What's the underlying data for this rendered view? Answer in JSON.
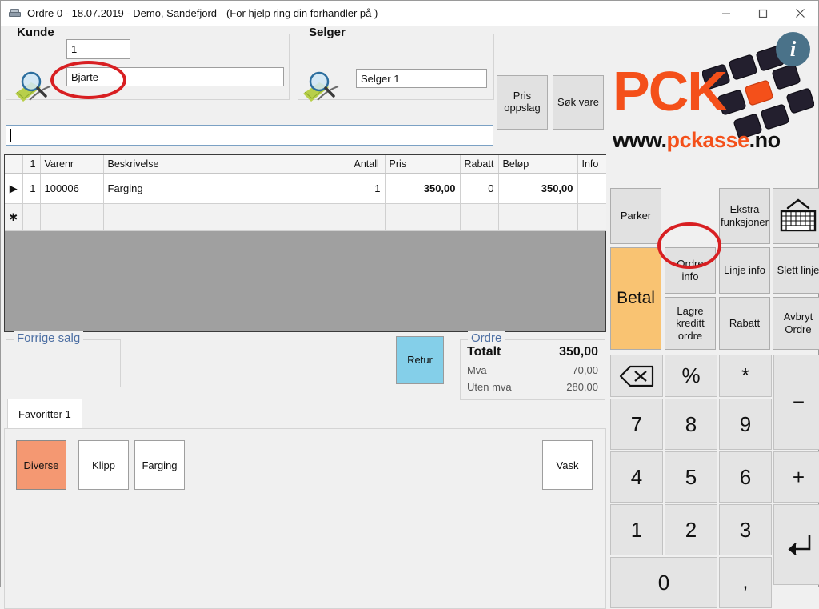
{
  "window": {
    "title": "Ordre 0 - 18.07.2019 - Demo, Sandefjord",
    "help_text": "(For hjelp ring din forhandler  på )",
    "icon": "printer-icon",
    "minimize_label": "minimize-icon",
    "maximize_label": "maximize-icon",
    "close_label": "close-icon"
  },
  "kunde": {
    "legend": "Kunde",
    "number_value": "1",
    "name_value": "Bjarte",
    "search_icon": "magnifier-icon"
  },
  "selger": {
    "legend": "Selger",
    "name_value": "Selger 1",
    "search_icon": "magnifier-icon"
  },
  "toolbar": {
    "pris_oppslag_line1": "Pris",
    "pris_oppslag_line2": "oppslag",
    "sok_vare": "Søk vare"
  },
  "scan": {
    "value": "",
    "placeholder": ""
  },
  "grid": {
    "columns": [
      "1",
      "Varenr",
      "Beskrivelse",
      "Antall",
      "Pris",
      "Rabatt",
      "Beløp",
      "Info"
    ],
    "rows": [
      {
        "marker": "▶",
        "num": "1",
        "varenr": "100006",
        "beskrivelse": "Farging",
        "antall": "1",
        "pris": "350,00",
        "rabatt": "0",
        "belop": "350,00",
        "info": ""
      }
    ],
    "new_row_marker": "✱"
  },
  "forrige_salg": {
    "legend": "Forrige salg"
  },
  "retur": {
    "label": "Retur"
  },
  "ordre_sum": {
    "legend": "Ordre",
    "total_label": "Totalt",
    "total_value": "350,00",
    "mva_label": "Mva",
    "mva_value": "70,00",
    "uten_mva_label": "Uten mva",
    "uten_mva_value": "280,00"
  },
  "favoritter": {
    "tab_label": "Favoritter 1",
    "buttons": [
      {
        "label": "Diverse",
        "selected": true
      },
      {
        "label": "Klipp",
        "selected": false
      },
      {
        "label": "Farging",
        "selected": false
      },
      {
        "label": "Vask",
        "selected": false
      }
    ]
  },
  "logo": {
    "brand": "PCK",
    "url_www": "www.",
    "url_name": "pckasse",
    "url_tld": ".no",
    "info_icon": "info-icon",
    "info_glyph": "i"
  },
  "actions": {
    "parker": "Parker",
    "ekstra_line1": "Ekstra",
    "ekstra_line2": "funksjoner",
    "keyboard_icon": "keyboard-icon",
    "betal": "Betal",
    "ordre_info_line1": "Ordre",
    "ordre_info_line2": "info",
    "linje_info": "Linje info",
    "slett_linje": "Slett linje",
    "lagre_line1": "Lagre",
    "lagre_line2": "kreditt",
    "lagre_line3": "ordre",
    "rabatt": "Rabatt",
    "avbryt_line1": "Avbryt",
    "avbryt_line2": "Ordre"
  },
  "keypad": {
    "backspace": "backspace-icon",
    "percent": "%",
    "asterisk": "*",
    "minus": "−",
    "k7": "7",
    "k8": "8",
    "k9": "9",
    "k4": "4",
    "k5": "5",
    "k6": "6",
    "plus": "+",
    "k1": "1",
    "k2": "2",
    "k3": "3",
    "k0": "0",
    "comma": ",",
    "enter": "enter-icon"
  },
  "annotations": {
    "highlight_color": "#d81f22",
    "items": [
      "kunde-name-highlight",
      "ordre-info-highlight"
    ]
  },
  "colors": {
    "accent_orange": "#f4501a",
    "betal": "#f9c372",
    "retur": "#84cfe9",
    "selected_cell": "#0b7ad6",
    "favorite_selected": "#f49872"
  }
}
